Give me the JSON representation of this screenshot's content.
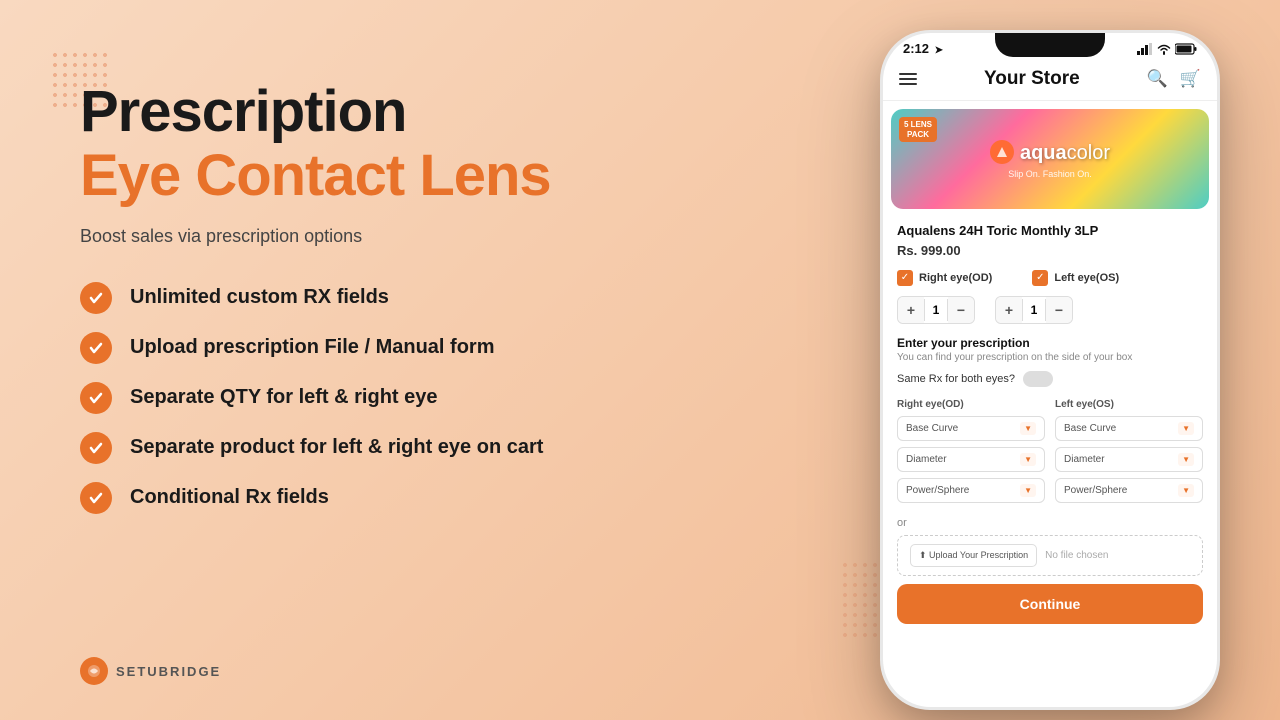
{
  "background": {
    "color": "#f5c9a8"
  },
  "left_panel": {
    "title_line1": "Prescription",
    "title_line2": "Eye Contact Lens",
    "subtitle": "Boost sales via prescription options",
    "features": [
      {
        "id": "feature-1",
        "text": "Unlimited custom RX fields"
      },
      {
        "id": "feature-2",
        "text": "Upload prescription File / Manual form"
      },
      {
        "id": "feature-3",
        "text": "Separate QTY for left & right eye"
      },
      {
        "id": "feature-4",
        "text": "Separate product for left & right eye on cart"
      },
      {
        "id": "feature-5",
        "text": "Conditional Rx fields"
      }
    ]
  },
  "logo": {
    "text": "SETUBRIDGE"
  },
  "phone": {
    "status_bar": {
      "time": "2:12",
      "time_icon": "➤",
      "signal": "📶",
      "wifi": "📡",
      "battery": "🔋"
    },
    "header": {
      "title": "Your Store",
      "menu_label": "☰",
      "search_label": "🔍",
      "cart_label": "🛒"
    },
    "product": {
      "badge_line1": "5 LENS",
      "badge_line2": "PACK",
      "logo_bold": "aqua",
      "logo_light": "color",
      "tagline": "Slip On. Fashion On.",
      "name": "Aqualens 24H Toric Monthly 3LP",
      "price": "Rs. 999.00"
    },
    "eye_selection": {
      "right_eye_label": "Right eye(OD)",
      "left_eye_label": "Left eye(OS)",
      "right_checked": true,
      "left_checked": true
    },
    "right_qty": {
      "minus": "−",
      "value": "1",
      "plus": "+"
    },
    "left_qty": {
      "minus": "−",
      "value": "1",
      "plus": "+"
    },
    "prescription": {
      "title": "Enter your prescription",
      "subtitle": "You can find your prescription on the side of your box",
      "same_rx_label": "Same Rx for both eyes?",
      "right_eye_col": "Right eye(OD)",
      "left_eye_col": "Left eye(OS)",
      "right_dropdowns": [
        "Base Curve",
        "Diameter",
        "Power/Sphere"
      ],
      "left_dropdowns": [
        "Base Curve",
        "Diameter",
        "Power/Sphere"
      ],
      "or_text": "or",
      "upload_btn": "⬆ Upload Your Prescription",
      "upload_placeholder": "No file chosen",
      "continue_btn": "Continue"
    }
  }
}
